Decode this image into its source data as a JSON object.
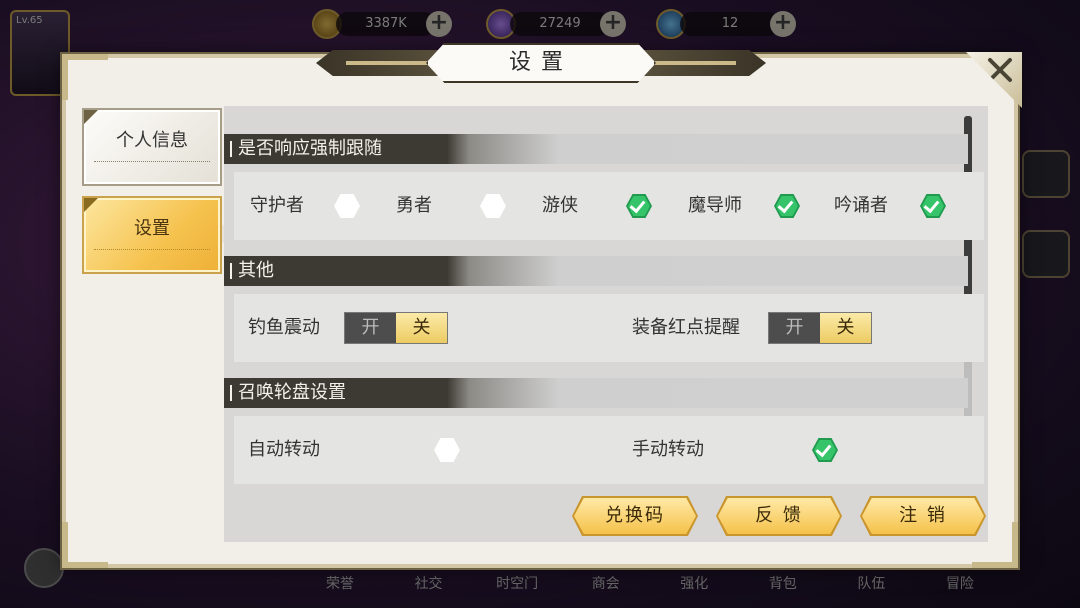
{
  "hud": {
    "level": "Lv.65",
    "gold": "3387K",
    "gems": "27249",
    "tickets": "12",
    "nav": [
      "荣誉",
      "社交",
      "时空门",
      "商会",
      "强化",
      "背包",
      "队伍",
      "冒险"
    ]
  },
  "dialog": {
    "title": "设置",
    "tabs": {
      "personal": "个人信息",
      "settings": "设置"
    }
  },
  "follow": {
    "header": "是否响应强制跟随",
    "options": [
      {
        "label": "守护者",
        "checked": false
      },
      {
        "label": "勇者",
        "checked": false
      },
      {
        "label": "游侠",
        "checked": true
      },
      {
        "label": "魔导师",
        "checked": true
      },
      {
        "label": "吟诵者",
        "checked": true
      }
    ]
  },
  "other": {
    "header": "其他",
    "fishing_vibration": {
      "label": "钓鱼震动",
      "on_label": "开",
      "off_label": "关",
      "state": "off"
    },
    "red_dot": {
      "label": "装备红点提醒",
      "on_label": "开",
      "off_label": "关",
      "state": "off"
    }
  },
  "wheel": {
    "header": "召唤轮盘设置",
    "auto": {
      "label": "自动转动",
      "checked": false
    },
    "manual": {
      "label": "手动转动",
      "checked": true
    }
  },
  "buttons": {
    "redeem": "兑换码",
    "feedback": "反 馈",
    "logout": "注 销"
  },
  "colors": {
    "accent_gold": "#f5c24a",
    "check_green": "#36c46a",
    "header_dark": "#3d3a33"
  }
}
